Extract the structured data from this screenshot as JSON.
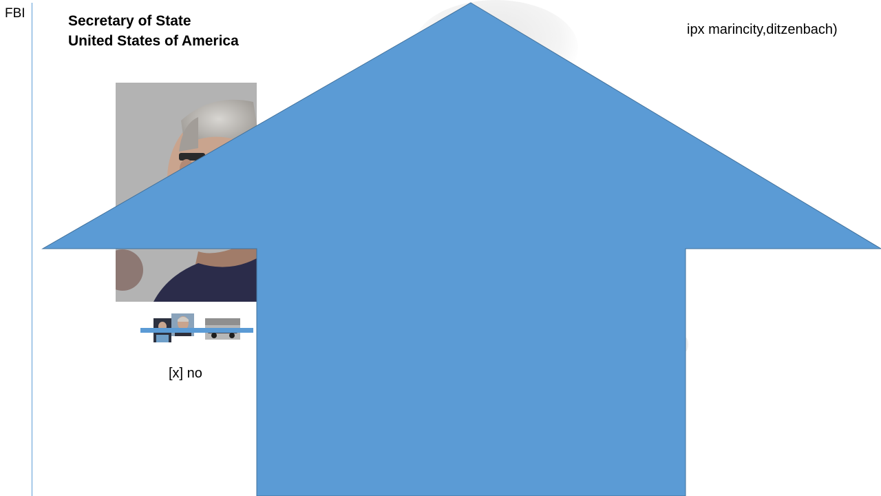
{
  "side_label": "FBI",
  "title": {
    "line1": "Secretary of State",
    "line2": "United States of America"
  },
  "corner_note": "ipx marincity,ditzenbach)",
  "status_line": "[x] no",
  "colors": {
    "accent_blue": "#5b9bd5",
    "arrow_stroke": "#41719c",
    "background": "#ffffff"
  },
  "icons": {
    "arrow": "up-arrow-shape",
    "photo": "portrait-photo",
    "thumbs": "thumbnail-strip"
  }
}
